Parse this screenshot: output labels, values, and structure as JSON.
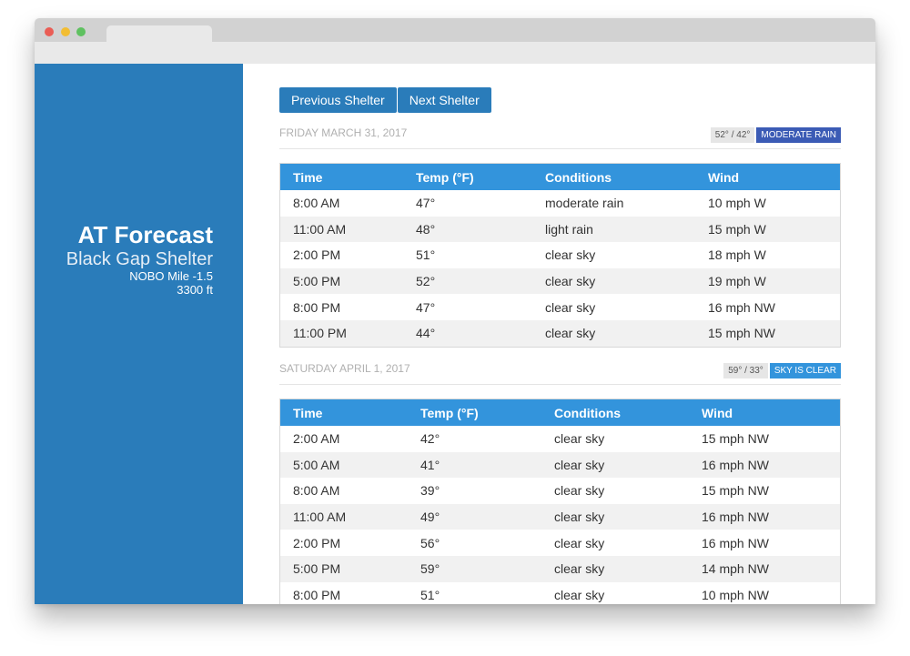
{
  "sidebar": {
    "app_title": "AT Forecast",
    "shelter_name": "Black Gap Shelter",
    "mile": "NOBO Mile -1.5",
    "elevation": "3300 ft"
  },
  "nav": {
    "previous": "Previous Shelter",
    "next": "Next Shelter"
  },
  "colors": {
    "sidebar": "#2a7cba",
    "table_header": "#3394dc",
    "moderate_rain": "#3b5bb5",
    "sky_is_clear": "#3394dc"
  },
  "columns": [
    "Time",
    "Temp (°F)",
    "Conditions",
    "Wind"
  ],
  "days": [
    {
      "date": "FRIDAY MARCH 31, 2017",
      "hi_lo": "52° / 42°",
      "condition": "MODERATE RAIN",
      "rows": [
        [
          "8:00 AM",
          "47°",
          "moderate rain",
          "10 mph W"
        ],
        [
          "11:00 AM",
          "48°",
          "light rain",
          "15 mph W"
        ],
        [
          "2:00 PM",
          "51°",
          "clear sky",
          "18 mph W"
        ],
        [
          "5:00 PM",
          "52°",
          "clear sky",
          "19 mph W"
        ],
        [
          "8:00 PM",
          "47°",
          "clear sky",
          "16 mph NW"
        ],
        [
          "11:00 PM",
          "44°",
          "clear sky",
          "15 mph NW"
        ]
      ]
    },
    {
      "date": "SATURDAY APRIL 1, 2017",
      "hi_lo": "59° / 33°",
      "condition": "SKY IS CLEAR",
      "rows": [
        [
          "2:00 AM",
          "42°",
          "clear sky",
          "15 mph NW"
        ],
        [
          "5:00 AM",
          "41°",
          "clear sky",
          "16 mph NW"
        ],
        [
          "8:00 AM",
          "39°",
          "clear sky",
          "15 mph NW"
        ],
        [
          "11:00 AM",
          "49°",
          "clear sky",
          "16 mph NW"
        ],
        [
          "2:00 PM",
          "56°",
          "clear sky",
          "16 mph NW"
        ],
        [
          "5:00 PM",
          "59°",
          "clear sky",
          "14 mph NW"
        ],
        [
          "8:00 PM",
          "51°",
          "clear sky",
          "10 mph NW"
        ]
      ]
    }
  ]
}
